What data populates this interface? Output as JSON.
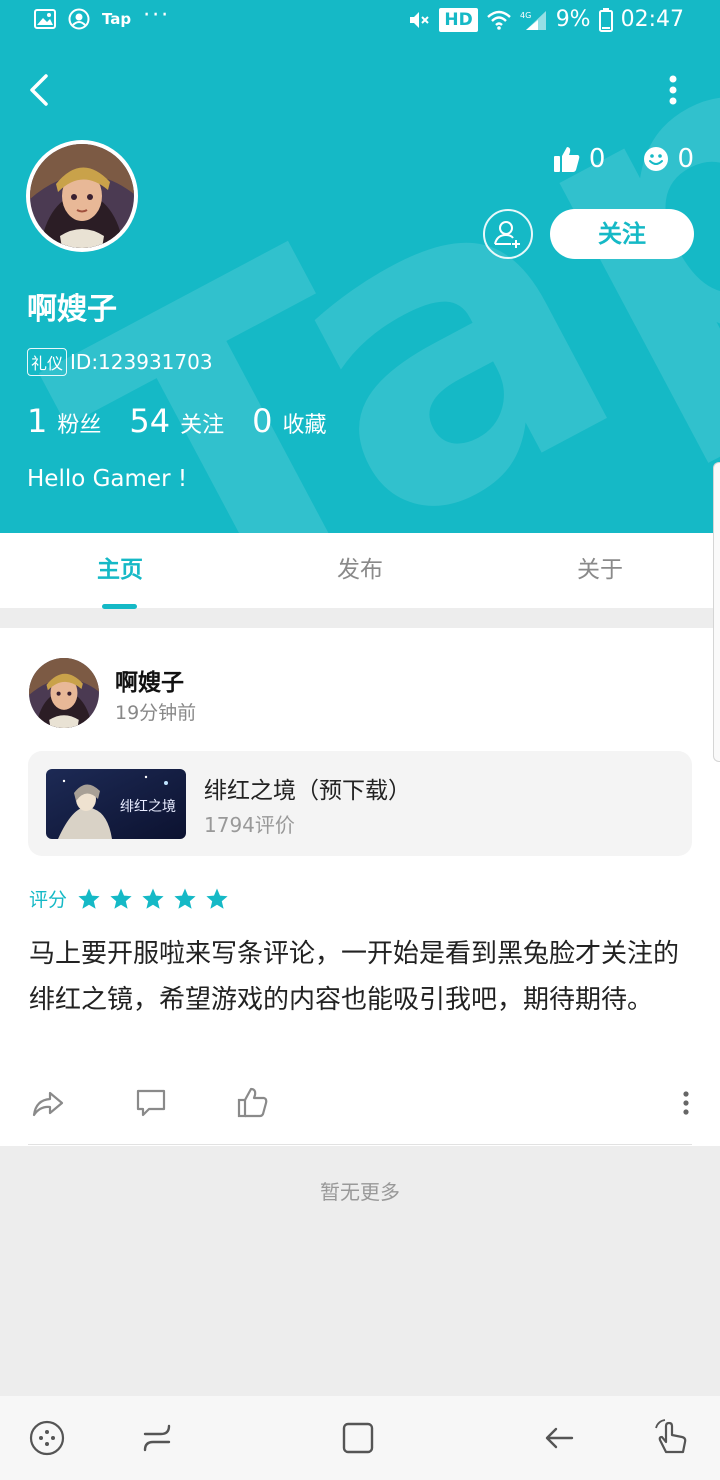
{
  "status_bar": {
    "tap_label": "Tap",
    "hd_badge": "HD",
    "network": "4G",
    "battery": "9%",
    "time": "02:47"
  },
  "profile": {
    "watermark_text": "Tap",
    "likes_count": "0",
    "mood_count": "0",
    "follow_label": "关注",
    "username": "啊嫂子",
    "badge_label": "礼仪",
    "id_text": "ID:123931703",
    "fans_count": "1",
    "fans_label": "粉丝",
    "following_count": "54",
    "following_label": "关注",
    "favorites_count": "0",
    "favorites_label": "收藏",
    "bio": "Hello Gamer !"
  },
  "tabs": [
    {
      "label": "主页",
      "active": true
    },
    {
      "label": "发布",
      "active": false
    },
    {
      "label": "关于",
      "active": false
    }
  ],
  "post": {
    "author": "啊嫂子",
    "time": "19分钟前",
    "game_name": "绯红之境（预下载）",
    "game_reviews": "1794评价",
    "game_thumb_text": "绯红之境",
    "rating_label": "评分",
    "rating": 5,
    "text": "马上要开服啦来写条评论，一开始是看到黑兔脸才关注的绯红之镜，希望游戏的内容也能吸引我吧，期待期待。"
  },
  "footer": {
    "no_more": "暂无更多"
  },
  "colors": {
    "accent": "#15b9c6"
  }
}
